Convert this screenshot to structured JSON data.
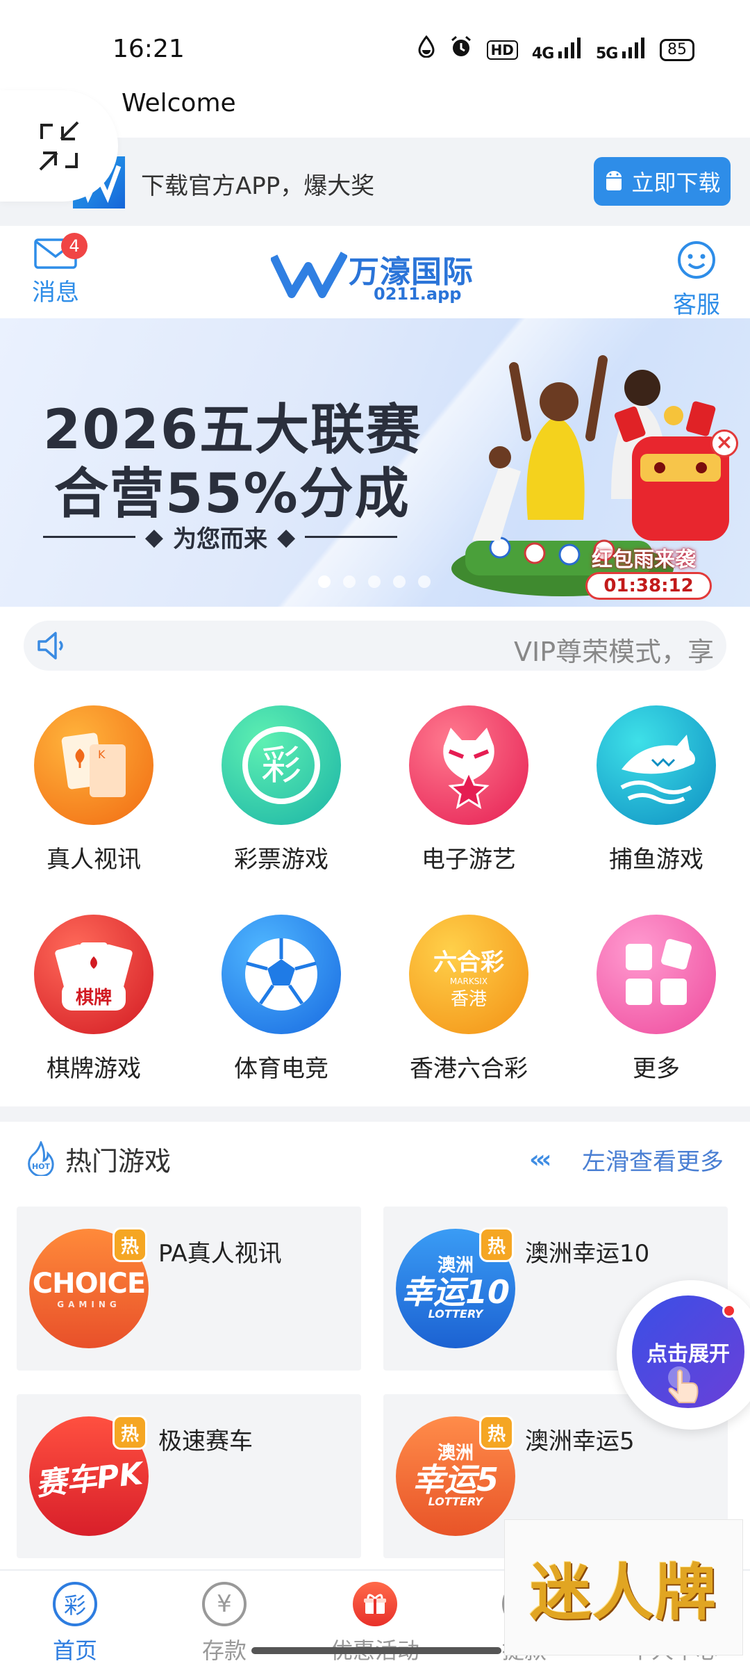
{
  "status_bar": {
    "time": "16:21",
    "icons": [
      "water-drop-icon",
      "alarm-icon",
      "hd-icon",
      "signal-4g-icon",
      "signal-5g-icon"
    ],
    "hd_label": "HD",
    "net1": "4G",
    "net2": "5G",
    "battery": "85"
  },
  "welcome": "Welcome",
  "download_banner": {
    "text": "下载官方APP，爆大奖",
    "button": "立即下载"
  },
  "header": {
    "messages_label": "消息",
    "messages_badge": "4",
    "brand_name": "万濠国际",
    "brand_sub": "0211.app",
    "service_label": "客服"
  },
  "hero": {
    "line1": "2026五大联赛",
    "line2": "合营55%分成",
    "line3": "为您而来",
    "promo_title": "红包雨来袭",
    "promo_timer": "01:38:12",
    "slides": 5,
    "active_slide": 0
  },
  "marquee": {
    "text": "VIP尊荣模式，享"
  },
  "categories": [
    {
      "label": "真人视讯",
      "icon": "cards-icon",
      "color": "#f58a1f"
    },
    {
      "label": "彩票游戏",
      "icon": "lottery-icon",
      "color": "#2fcf9f"
    },
    {
      "label": "电子游艺",
      "icon": "devil-icon",
      "color": "#f0416a"
    },
    {
      "label": "捕鱼游戏",
      "icon": "shark-icon",
      "color": "#1fb3d1"
    },
    {
      "label": "棋牌游戏",
      "icon": "poker-icon",
      "color": "#e8323a"
    },
    {
      "label": "体育电竞",
      "icon": "soccer-icon",
      "color": "#2b8ef0"
    },
    {
      "label": "香港六合彩",
      "icon": "marksix-icon",
      "color": "#f6a423"
    },
    {
      "label": "更多",
      "icon": "grid-icon",
      "color": "#f05fa8"
    }
  ],
  "hot": {
    "title": "热门游戏",
    "more": "左滑查看更多",
    "badge": "热",
    "games": [
      {
        "name": "PA真人视讯",
        "logo": "CHOICE",
        "logo_sub": "GAMING",
        "color": "#f26a2a"
      },
      {
        "name": "澳洲幸运10",
        "logo": "幸运10",
        "logo_top": "澳洲",
        "logo_sub": "LOTTERY",
        "color": "#2a7ee0"
      },
      {
        "name": "极速赛车",
        "logo": "赛车PK",
        "color": "#e63434"
      },
      {
        "name": "澳洲幸运5",
        "logo": "幸运5",
        "logo_top": "澳洲",
        "logo_sub": "LOTTERY",
        "color": "#f46a2a"
      }
    ]
  },
  "expand_button": "点击展开",
  "bottom_nav": [
    {
      "label": "首页",
      "icon": "lottery-icon",
      "active": true
    },
    {
      "label": "存款",
      "icon": "yen-icon",
      "active": false
    },
    {
      "label": "优惠活动",
      "icon": "gift-icon",
      "active": false
    },
    {
      "label": "提款",
      "icon": "withdraw-icon",
      "active": false
    },
    {
      "label": "个人中心",
      "icon": "user-icon",
      "active": false
    }
  ],
  "overlay_ad": "迷人牌"
}
